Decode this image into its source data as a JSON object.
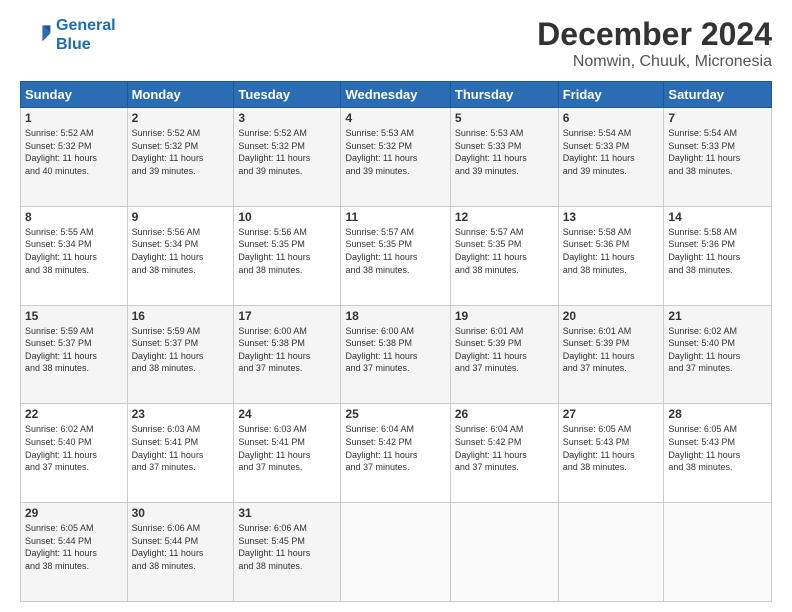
{
  "logo": {
    "line1": "General",
    "line2": "Blue"
  },
  "title": "December 2024",
  "subtitle": "Nomwin, Chuuk, Micronesia",
  "days_of_week": [
    "Sunday",
    "Monday",
    "Tuesday",
    "Wednesday",
    "Thursday",
    "Friday",
    "Saturday"
  ],
  "weeks": [
    [
      {
        "day": "1",
        "info": "Sunrise: 5:52 AM\nSunset: 5:32 PM\nDaylight: 11 hours\nand 40 minutes."
      },
      {
        "day": "2",
        "info": "Sunrise: 5:52 AM\nSunset: 5:32 PM\nDaylight: 11 hours\nand 39 minutes."
      },
      {
        "day": "3",
        "info": "Sunrise: 5:52 AM\nSunset: 5:32 PM\nDaylight: 11 hours\nand 39 minutes."
      },
      {
        "day": "4",
        "info": "Sunrise: 5:53 AM\nSunset: 5:32 PM\nDaylight: 11 hours\nand 39 minutes."
      },
      {
        "day": "5",
        "info": "Sunrise: 5:53 AM\nSunset: 5:33 PM\nDaylight: 11 hours\nand 39 minutes."
      },
      {
        "day": "6",
        "info": "Sunrise: 5:54 AM\nSunset: 5:33 PM\nDaylight: 11 hours\nand 39 minutes."
      },
      {
        "day": "7",
        "info": "Sunrise: 5:54 AM\nSunset: 5:33 PM\nDaylight: 11 hours\nand 38 minutes."
      }
    ],
    [
      {
        "day": "8",
        "info": "Sunrise: 5:55 AM\nSunset: 5:34 PM\nDaylight: 11 hours\nand 38 minutes."
      },
      {
        "day": "9",
        "info": "Sunrise: 5:56 AM\nSunset: 5:34 PM\nDaylight: 11 hours\nand 38 minutes."
      },
      {
        "day": "10",
        "info": "Sunrise: 5:56 AM\nSunset: 5:35 PM\nDaylight: 11 hours\nand 38 minutes."
      },
      {
        "day": "11",
        "info": "Sunrise: 5:57 AM\nSunset: 5:35 PM\nDaylight: 11 hours\nand 38 minutes."
      },
      {
        "day": "12",
        "info": "Sunrise: 5:57 AM\nSunset: 5:35 PM\nDaylight: 11 hours\nand 38 minutes."
      },
      {
        "day": "13",
        "info": "Sunrise: 5:58 AM\nSunset: 5:36 PM\nDaylight: 11 hours\nand 38 minutes."
      },
      {
        "day": "14",
        "info": "Sunrise: 5:58 AM\nSunset: 5:36 PM\nDaylight: 11 hours\nand 38 minutes."
      }
    ],
    [
      {
        "day": "15",
        "info": "Sunrise: 5:59 AM\nSunset: 5:37 PM\nDaylight: 11 hours\nand 38 minutes."
      },
      {
        "day": "16",
        "info": "Sunrise: 5:59 AM\nSunset: 5:37 PM\nDaylight: 11 hours\nand 38 minutes."
      },
      {
        "day": "17",
        "info": "Sunrise: 6:00 AM\nSunset: 5:38 PM\nDaylight: 11 hours\nand 37 minutes."
      },
      {
        "day": "18",
        "info": "Sunrise: 6:00 AM\nSunset: 5:38 PM\nDaylight: 11 hours\nand 37 minutes."
      },
      {
        "day": "19",
        "info": "Sunrise: 6:01 AM\nSunset: 5:39 PM\nDaylight: 11 hours\nand 37 minutes."
      },
      {
        "day": "20",
        "info": "Sunrise: 6:01 AM\nSunset: 5:39 PM\nDaylight: 11 hours\nand 37 minutes."
      },
      {
        "day": "21",
        "info": "Sunrise: 6:02 AM\nSunset: 5:40 PM\nDaylight: 11 hours\nand 37 minutes."
      }
    ],
    [
      {
        "day": "22",
        "info": "Sunrise: 6:02 AM\nSunset: 5:40 PM\nDaylight: 11 hours\nand 37 minutes."
      },
      {
        "day": "23",
        "info": "Sunrise: 6:03 AM\nSunset: 5:41 PM\nDaylight: 11 hours\nand 37 minutes."
      },
      {
        "day": "24",
        "info": "Sunrise: 6:03 AM\nSunset: 5:41 PM\nDaylight: 11 hours\nand 37 minutes."
      },
      {
        "day": "25",
        "info": "Sunrise: 6:04 AM\nSunset: 5:42 PM\nDaylight: 11 hours\nand 37 minutes."
      },
      {
        "day": "26",
        "info": "Sunrise: 6:04 AM\nSunset: 5:42 PM\nDaylight: 11 hours\nand 37 minutes."
      },
      {
        "day": "27",
        "info": "Sunrise: 6:05 AM\nSunset: 5:43 PM\nDaylight: 11 hours\nand 38 minutes."
      },
      {
        "day": "28",
        "info": "Sunrise: 6:05 AM\nSunset: 5:43 PM\nDaylight: 11 hours\nand 38 minutes."
      }
    ],
    [
      {
        "day": "29",
        "info": "Sunrise: 6:05 AM\nSunset: 5:44 PM\nDaylight: 11 hours\nand 38 minutes."
      },
      {
        "day": "30",
        "info": "Sunrise: 6:06 AM\nSunset: 5:44 PM\nDaylight: 11 hours\nand 38 minutes."
      },
      {
        "day": "31",
        "info": "Sunrise: 6:06 AM\nSunset: 5:45 PM\nDaylight: 11 hours\nand 38 minutes."
      },
      {
        "day": "",
        "info": ""
      },
      {
        "day": "",
        "info": ""
      },
      {
        "day": "",
        "info": ""
      },
      {
        "day": "",
        "info": ""
      }
    ]
  ]
}
